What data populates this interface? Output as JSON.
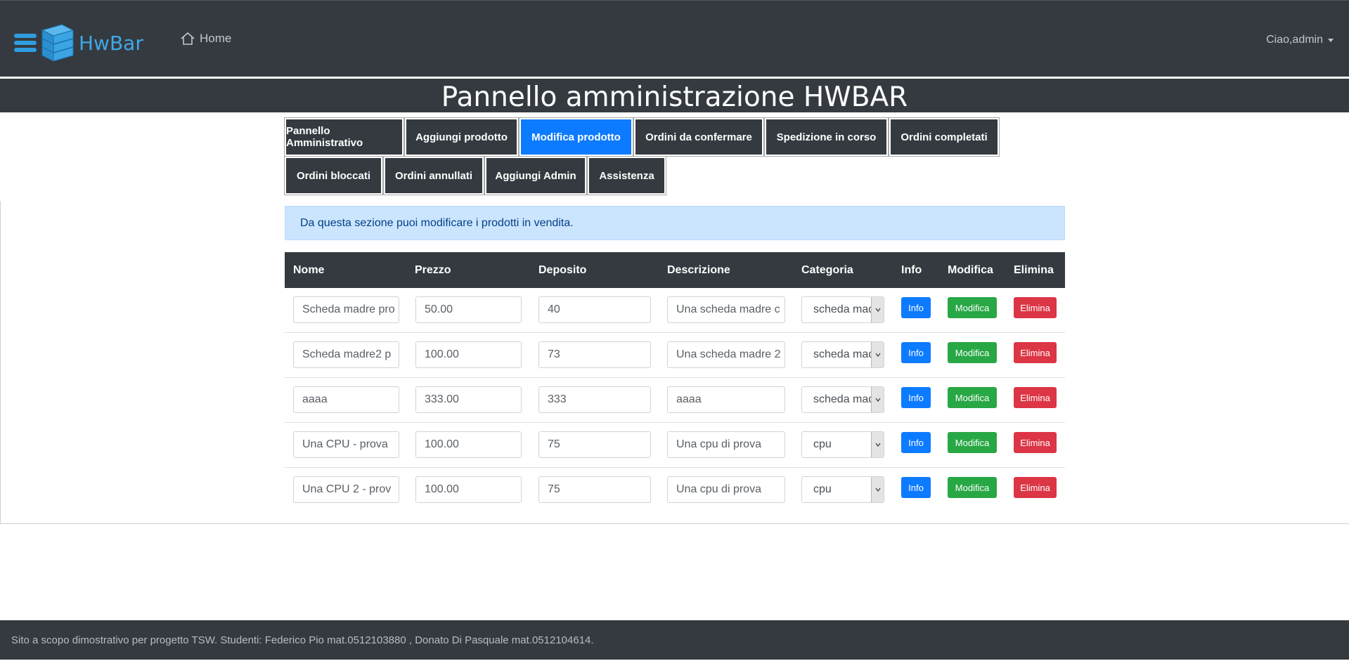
{
  "navbar": {
    "brand": "HwBar",
    "home_label": "Home",
    "user_label": "Ciao,admin"
  },
  "page_title": "Pannello amministrazione HWBAR",
  "tabs": [
    {
      "label": "Pannello Amministrativo",
      "active": false
    },
    {
      "label": "Aggiungi prodotto",
      "active": false
    },
    {
      "label": "Modifica prodotto",
      "active": true
    },
    {
      "label": "Ordini da confermare",
      "active": false
    },
    {
      "label": "Spedizione in corso",
      "active": false
    },
    {
      "label": "Ordini completati",
      "active": false
    },
    {
      "label": "Ordini bloccati",
      "active": false
    },
    {
      "label": "Ordini annullati",
      "active": false
    },
    {
      "label": "Aggiungi Admin",
      "active": false
    },
    {
      "label": "Assistenza",
      "active": false
    }
  ],
  "alert": "Da questa sezione puoi modificare i prodotti in vendita.",
  "table": {
    "headers": [
      "Nome",
      "Prezzo",
      "Deposito",
      "Descrizione",
      "Categoria",
      "Info",
      "Modifica",
      "Elimina"
    ],
    "rows": [
      {
        "nome": "Scheda madre pro",
        "prezzo": "50.00",
        "deposito": "40",
        "descrizione": "Una scheda madre c",
        "categoria": "scheda madre"
      },
      {
        "nome": "Scheda madre2 p",
        "prezzo": "100.00",
        "deposito": "73",
        "descrizione": "Una scheda madre 2",
        "categoria": "scheda madre"
      },
      {
        "nome": "aaaa",
        "prezzo": "333.00",
        "deposito": "333",
        "descrizione": "aaaa",
        "categoria": "scheda madre"
      },
      {
        "nome": "Una CPU - prova",
        "prezzo": "100.00",
        "deposito": "75",
        "descrizione": "Una cpu di prova",
        "categoria": "cpu"
      },
      {
        "nome": "Una CPU 2 - prov",
        "prezzo": "100.00",
        "deposito": "75",
        "descrizione": "Una cpu di prova",
        "categoria": "cpu"
      }
    ],
    "button_labels": {
      "info": "Info",
      "modifica": "Modifica",
      "elimina": "Elimina"
    }
  },
  "footer": "Sito a scopo dimostrativo per progetto TSW. Studenti: Federico Pio mat.0512103880 , Donato Di Pasquale mat.0512104614.",
  "colors": {
    "dark": "#343a40",
    "primary": "#0d7bff",
    "success": "#28a745",
    "danger": "#dc3545",
    "alert_bg": "#cce5ff",
    "brand": "#3fa8e6"
  }
}
